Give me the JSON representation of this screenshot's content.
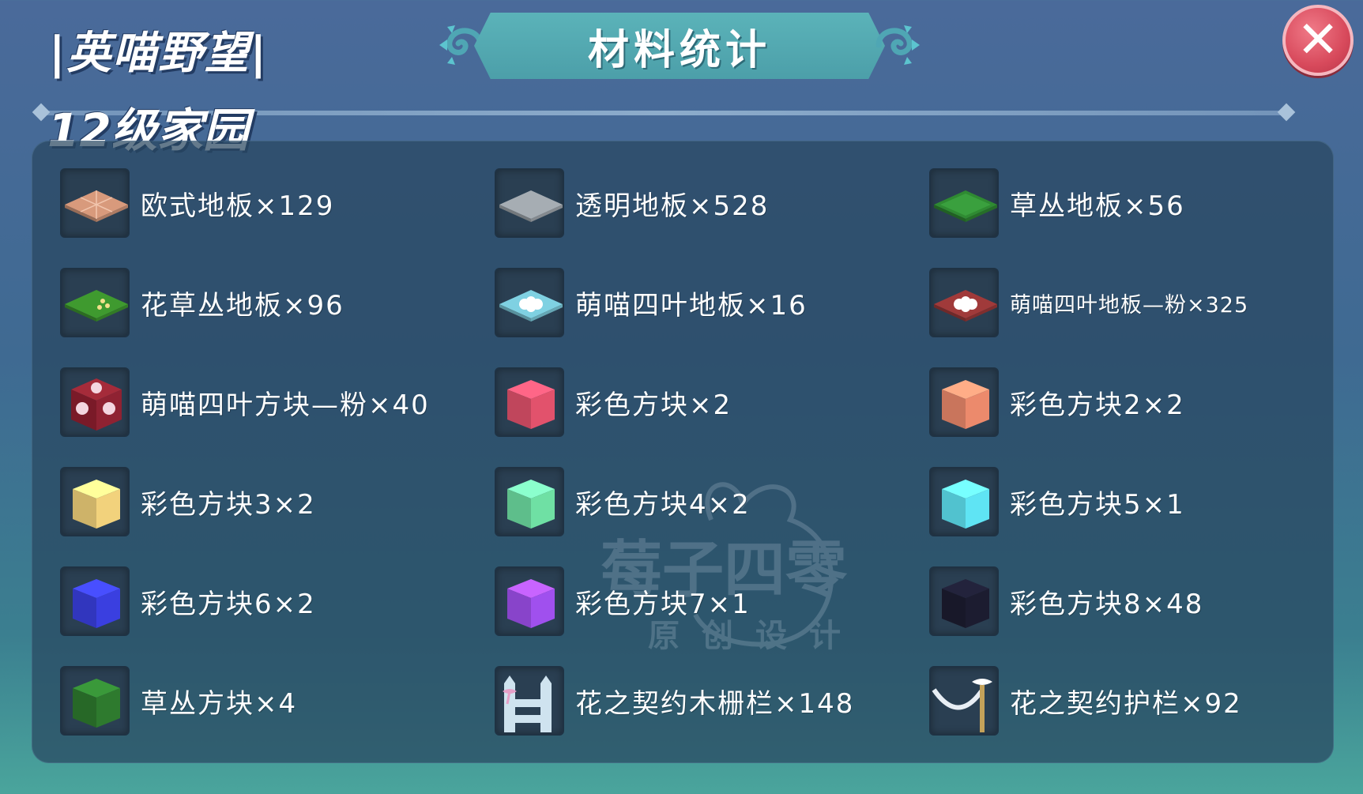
{
  "header": {
    "brand": "|英喵野望|",
    "level": "12级家园",
    "title": "材料统计",
    "close_label": "✕"
  },
  "items": [
    {
      "label": "欧式地板×129",
      "icon": "euro-floor-tile-icon",
      "color": "#d89a7c"
    },
    {
      "label": "透明地板×528",
      "icon": "transparent-floor-tile-icon",
      "color": "#a6adb3"
    },
    {
      "label": "草丛地板×56",
      "icon": "grass-floor-tile-icon",
      "color": "#2f8a32"
    },
    {
      "label": "花草丛地板×96",
      "icon": "flower-grass-floor-tile-icon",
      "color": "#3f9a2f"
    },
    {
      "label": "萌喵四叶地板×16",
      "icon": "clover-floor-tile-icon",
      "color": "#7fd1e2"
    },
    {
      "label": "萌喵四叶地板—粉×325",
      "icon": "clover-floor-tile-pink-icon",
      "color": "#a03a3a"
    },
    {
      "label": "萌喵四叶方块—粉×40",
      "icon": "clover-block-pink-icon",
      "color": "#8a1f2c"
    },
    {
      "label": "彩色方块×2",
      "icon": "color-block-red-icon",
      "color": "#e2526c"
    },
    {
      "label": "彩色方块2×2",
      "icon": "color-block-orange-icon",
      "color": "#ec8a6c"
    },
    {
      "label": "彩色方块3×2",
      "icon": "color-block-yellow-icon",
      "color": "#f2d27c"
    },
    {
      "label": "彩色方块4×2",
      "icon": "color-block-green-icon",
      "color": "#6fe0a4"
    },
    {
      "label": "彩色方块5×1",
      "icon": "color-block-cyan-icon",
      "color": "#5fe4f4"
    },
    {
      "label": "彩色方块6×2",
      "icon": "color-block-blue-icon",
      "color": "#3a3fe0"
    },
    {
      "label": "彩色方块7×1",
      "icon": "color-block-purple-icon",
      "color": "#a050ee"
    },
    {
      "label": "彩色方块8×48",
      "icon": "color-block-black-icon",
      "color": "#1c1c30"
    },
    {
      "label": "草丛方块×4",
      "icon": "grass-block-icon",
      "color": "#2e7a2e"
    },
    {
      "label": "花之契约木栅栏×148",
      "icon": "flower-fence-icon",
      "color": "#cfe3ef"
    },
    {
      "label": "花之契约护栏×92",
      "icon": "flower-railing-icon",
      "color": "#e8eef4"
    }
  ],
  "watermark": {
    "main": "莓子四零",
    "sub": "原创设计"
  }
}
